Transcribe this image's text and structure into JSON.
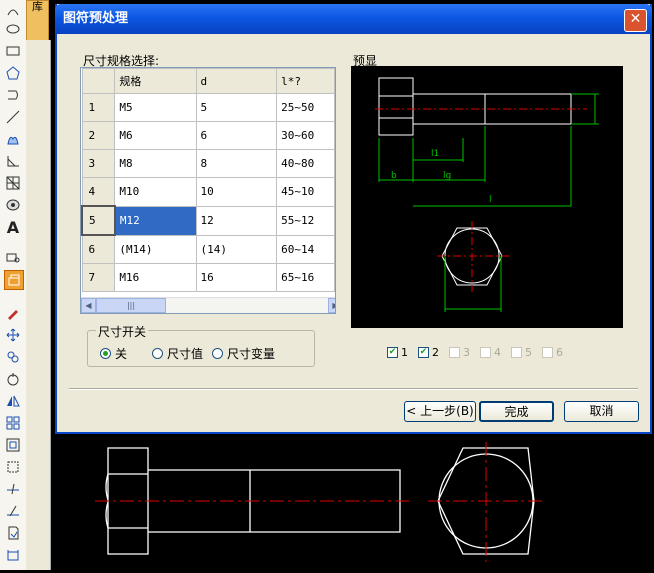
{
  "side_tab": {
    "label": "库"
  },
  "dialog": {
    "title": "图符预处理",
    "close_label": "✕",
    "size_select_label": "尺寸规格选择:",
    "preview_label": "预显",
    "grid": {
      "headers": [
        "",
        "规格",
        "d",
        "l*?"
      ],
      "rows": [
        {
          "num": "1",
          "spec": "M5",
          "d": "5",
          "l": "25~50"
        },
        {
          "num": "2",
          "spec": "M6",
          "d": "6",
          "l": "30~60"
        },
        {
          "num": "3",
          "spec": "M8",
          "d": "8",
          "l": "40~80"
        },
        {
          "num": "4",
          "spec": "M10",
          "d": "10",
          "l": "45~10"
        },
        {
          "num": "5",
          "spec": "M12",
          "d": "12",
          "l": "55~12"
        },
        {
          "num": "6",
          "spec": "(M14)",
          "d": "(14)",
          "l": "60~14"
        },
        {
          "num": "7",
          "spec": "M16",
          "d": "16",
          "l": "65~16"
        }
      ],
      "selected_row": 5
    },
    "size_switch": {
      "caption": "尺寸开关",
      "options": [
        {
          "label": "关",
          "checked": true
        },
        {
          "label": "尺寸值",
          "checked": false
        },
        {
          "label": "尺寸变量",
          "checked": false
        }
      ]
    },
    "view_checks": [
      {
        "label": "1",
        "checked": true,
        "enabled": true
      },
      {
        "label": "2",
        "checked": true,
        "enabled": true
      },
      {
        "label": "3",
        "checked": false,
        "enabled": false
      },
      {
        "label": "4",
        "checked": false,
        "enabled": false
      },
      {
        "label": "5",
        "checked": false,
        "enabled": false
      },
      {
        "label": "6",
        "checked": false,
        "enabled": false
      }
    ],
    "preview_labels": {
      "l1": "l1",
      "b": "b",
      "lg": "lg",
      "l": "l"
    },
    "buttons": {
      "back": "< 上一步(B)",
      "finish": "完成",
      "cancel": "取消"
    }
  },
  "colors": {
    "title_blue": "#0a55e0",
    "selection": "#316ac5",
    "preview_bg": "#000000",
    "outline": "#ffffff",
    "dim_green": "#00c000",
    "center_red": "#e00000"
  }
}
